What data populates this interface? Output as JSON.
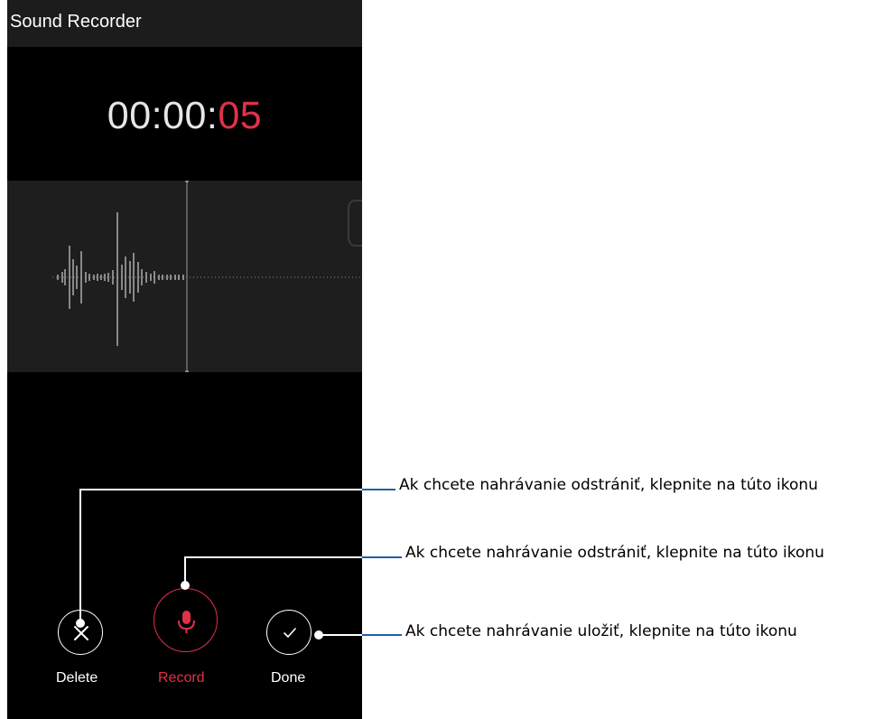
{
  "app": {
    "title": "Sound Recorder"
  },
  "timer": {
    "prefix": "00:00:",
    "seconds": "05",
    "accent_color": "#e0314b"
  },
  "controls": {
    "delete": {
      "label": "Delete",
      "icon": "close-icon"
    },
    "record": {
      "label": "Record",
      "icon": "microphone-icon"
    },
    "done": {
      "label": "Done",
      "icon": "checkmark-icon"
    }
  },
  "annotations": [
    {
      "text": "Ak chcete nahrávanie odstrániť, klepnite na túto ikonu"
    },
    {
      "text": "Ak chcete nahrávanie odstrániť, klepnite na túto ikonu"
    },
    {
      "text": "Ak chcete nahrávanie uložiť, klepnite na túto ikonu"
    }
  ]
}
